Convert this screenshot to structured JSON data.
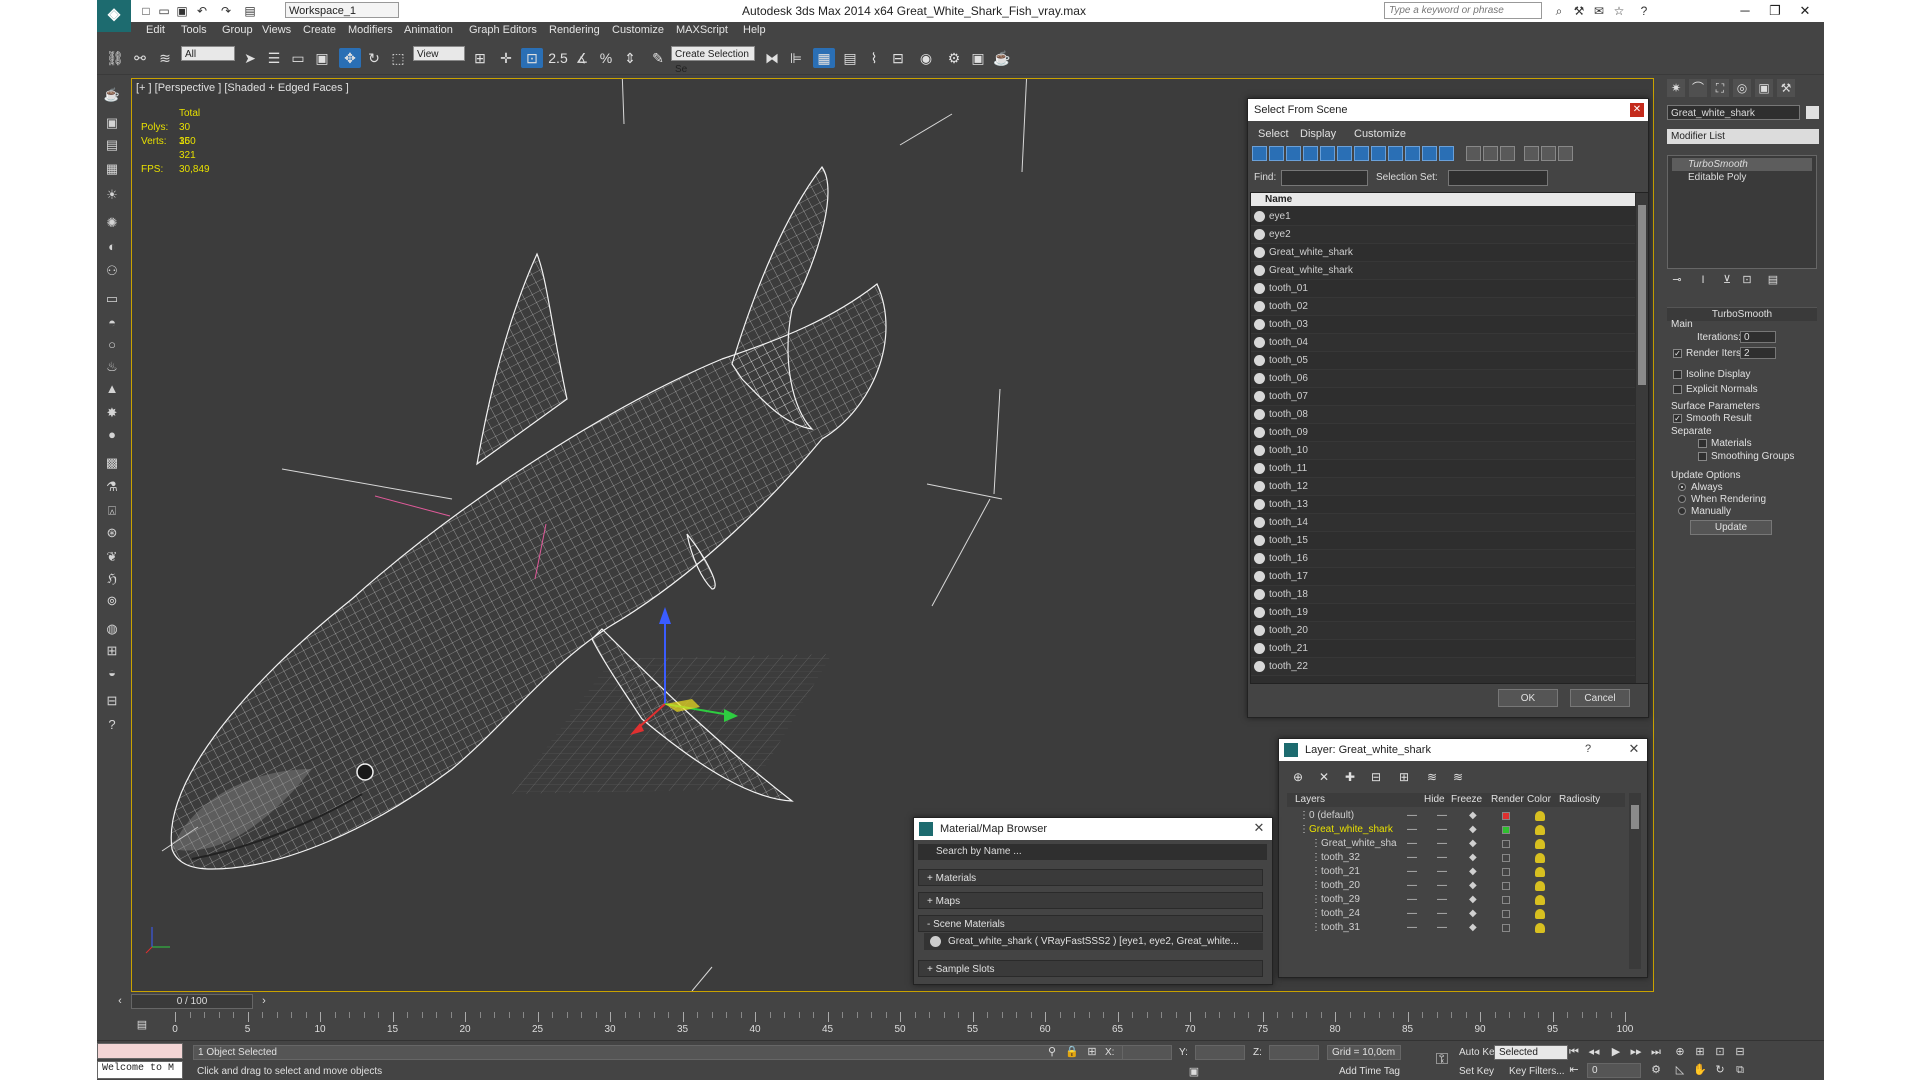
{
  "titlebar": {
    "title": "Autodesk 3ds Max  2014 x64     Great_White_Shark_Fish_vray.max",
    "workspace": "Workspace_1",
    "search_placeholder": "Type a keyword or phrase"
  },
  "menu": [
    "Edit",
    "Tools",
    "Group",
    "Views",
    "Create",
    "Modifiers",
    "Animation",
    "Graph Editors",
    "Rendering",
    "Customize",
    "MAXScript",
    "Help"
  ],
  "toolbar": {
    "filter": "All",
    "ref_coord": "View",
    "selection_set": "Create Selection Se",
    "snap_value": "2.5"
  },
  "viewport": {
    "label": "[+ ] [Perspective ] [Shaded + Edged Faces ]",
    "stats": {
      "total_label": "Total",
      "polys_label": "Polys:",
      "polys": "30 360",
      "verts_label": "Verts:",
      "verts": "15 321",
      "fps_label": "FPS:",
      "fps": "30,849"
    }
  },
  "select_from_scene": {
    "title": "Select From Scene",
    "menu": [
      "Select",
      "Display",
      "Customize"
    ],
    "find_label": "Find:",
    "selection_set_label": "Selection Set:",
    "column_name": "Name",
    "items": [
      "eye1",
      "eye2",
      "Great_white_shark",
      "Great_white_shark",
      "tooth_01",
      "tooth_02",
      "tooth_03",
      "tooth_04",
      "tooth_05",
      "tooth_06",
      "tooth_07",
      "tooth_08",
      "tooth_09",
      "tooth_10",
      "tooth_11",
      "tooth_12",
      "tooth_13",
      "tooth_14",
      "tooth_15",
      "tooth_16",
      "tooth_17",
      "tooth_18",
      "tooth_19",
      "tooth_20",
      "tooth_21",
      "tooth_22"
    ],
    "ok": "OK",
    "cancel": "Cancel"
  },
  "layer_dialog": {
    "title": "Layer: Great_white_shark",
    "help": "?",
    "columns": [
      "Layers",
      "Hide",
      "Freeze",
      "Render",
      "Color",
      "Radiosity"
    ],
    "rows": [
      {
        "name": "0 (default)",
        "indent": 1,
        "color": "#e03030"
      },
      {
        "name": "Great_white_shark",
        "indent": 1,
        "color": "#30c030"
      },
      {
        "name": "Great_white_sha",
        "indent": 2,
        "color": ""
      },
      {
        "name": "tooth_32",
        "indent": 2,
        "color": ""
      },
      {
        "name": "tooth_21",
        "indent": 2,
        "color": ""
      },
      {
        "name": "tooth_20",
        "indent": 2,
        "color": ""
      },
      {
        "name": "tooth_29",
        "indent": 2,
        "color": ""
      },
      {
        "name": "tooth_24",
        "indent": 2,
        "color": ""
      },
      {
        "name": "tooth_31",
        "indent": 2,
        "color": ""
      }
    ]
  },
  "material_browser": {
    "title": "Material/Map Browser",
    "search_placeholder": "Search by Name ...",
    "sections": [
      "+ Materials",
      "+ Maps",
      "- Scene Materials"
    ],
    "material": "Great_white_shark  ( VRayFastSSS2 )  [eye1, eye2, Great_white...",
    "sample_slots": "+ Sample Slots"
  },
  "command_panel": {
    "object_name": "Great_white_shark",
    "modifier_list": "Modifier List",
    "stack": [
      "TurboSmooth",
      "Editable Poly"
    ],
    "rollout_title": "TurboSmooth",
    "main_label": "Main",
    "iterations_label": "Iterations:",
    "iterations": "0",
    "render_iters_label": "Render Iters:",
    "render_iters": "2",
    "isoline": "Isoline Display",
    "explicit_normals": "Explicit Normals",
    "surface_params": "Surface Parameters",
    "smooth_result": "Smooth Result",
    "separate": "Separate",
    "materials": "Materials",
    "smoothing_groups": "Smoothing Groups",
    "update_options": "Update Options",
    "always": "Always",
    "when_rendering": "When Rendering",
    "manually": "Manually",
    "update": "Update"
  },
  "timeline": {
    "frame": "0 / 100",
    "ticks": [
      "0",
      "5",
      "10",
      "15",
      "20",
      "25",
      "30",
      "35",
      "40",
      "45",
      "50",
      "55",
      "60",
      "65",
      "70",
      "75",
      "80",
      "85",
      "90",
      "95",
      "100"
    ]
  },
  "statusbar": {
    "script": "Welcome to M",
    "selected": "1 Object Selected",
    "prompt": "Click and drag to select and move objects",
    "x_label": "X:",
    "y_label": "Y:",
    "z_label": "Z:",
    "grid": "Grid = 10,0cm",
    "auto_key": "Auto Key",
    "set_key": "Set Key",
    "key_mode": "Selected",
    "key_filters": "Key Filters...",
    "add_time_tag": "Add Time Tag",
    "frame": "0"
  }
}
